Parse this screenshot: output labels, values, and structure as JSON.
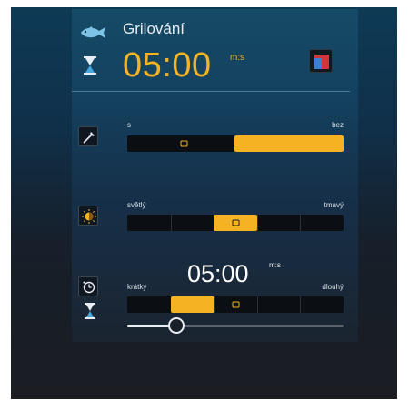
{
  "header": {
    "title": "Grilování",
    "time": "05:00",
    "time_unit": "m:s",
    "program_icon": "fish-icon",
    "timer_icon": "hourglass-icon",
    "rack_icon": "grill-rack-icon"
  },
  "sliders": [
    {
      "name": "crispness",
      "icon": "probe-icon",
      "left_label": "s",
      "right_label": "bez",
      "level_segments_selected": [
        3,
        4
      ],
      "segments": 4
    },
    {
      "name": "browning",
      "icon": "sun-shade-icon",
      "left_label": "světlý",
      "right_label": "tmavý",
      "selected_segment": 4,
      "segments": 7
    },
    {
      "name": "duration",
      "icon": "clock-reset-icon",
      "left_label": "krátký",
      "right_label": "dlouhý",
      "time": "05:00",
      "time_unit": "m:s",
      "selected_segment": 2,
      "segments": 5
    }
  ],
  "fine_slider": {
    "value_fraction": 0.23
  },
  "colors": {
    "accent": "#f5b323",
    "panel": "#154a66",
    "track": "#0b0f13",
    "text": "#e8eef2"
  }
}
